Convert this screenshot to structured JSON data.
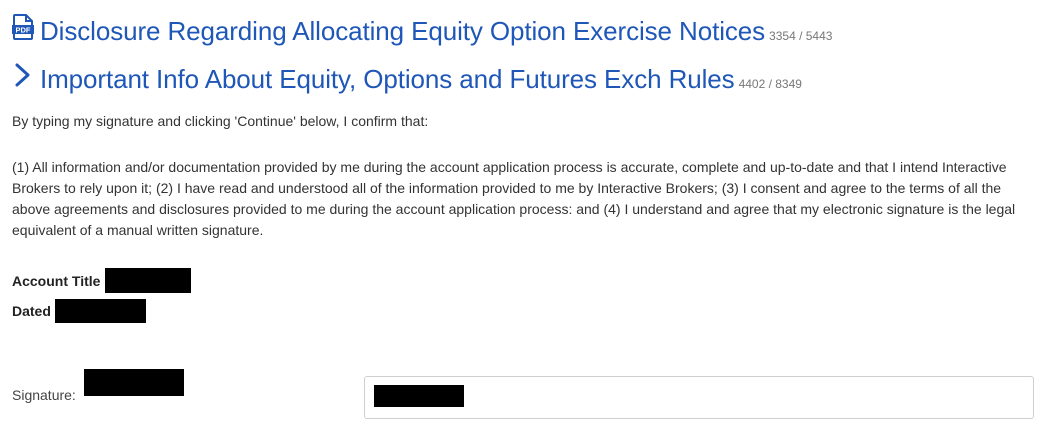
{
  "documents": [
    {
      "title": "Disclosure Regarding Allocating Equity Option Exercise Notices",
      "count": "3354 / 5443",
      "icon": "pdf-icon"
    },
    {
      "title": "Important Info About Equity, Options and Futures Exch Rules",
      "count": "4402 / 8349",
      "icon": "chevron-right-icon"
    }
  ],
  "intro_text": "By typing my signature and clicking 'Continue' below, I confirm that:",
  "confirmation_text": "(1) All information and/or documentation provided by me during the account application process is accurate, complete and up-to-date and that I intend Interactive Brokers to rely upon it; (2) I have read and understood all of the information provided to me by Interactive Brokers; (3) I consent and agree to the terms of all the above agreements and disclosures provided to me during the account application process: and (4) I understand and agree that my electronic signature is the legal equivalent of a manual written signature.",
  "fields": {
    "account_title_label": "Account Title",
    "dated_label": "Dated",
    "signature_label": "Signature:"
  },
  "colors": {
    "link_blue": "#1f57b8",
    "redaction": "#000000"
  }
}
